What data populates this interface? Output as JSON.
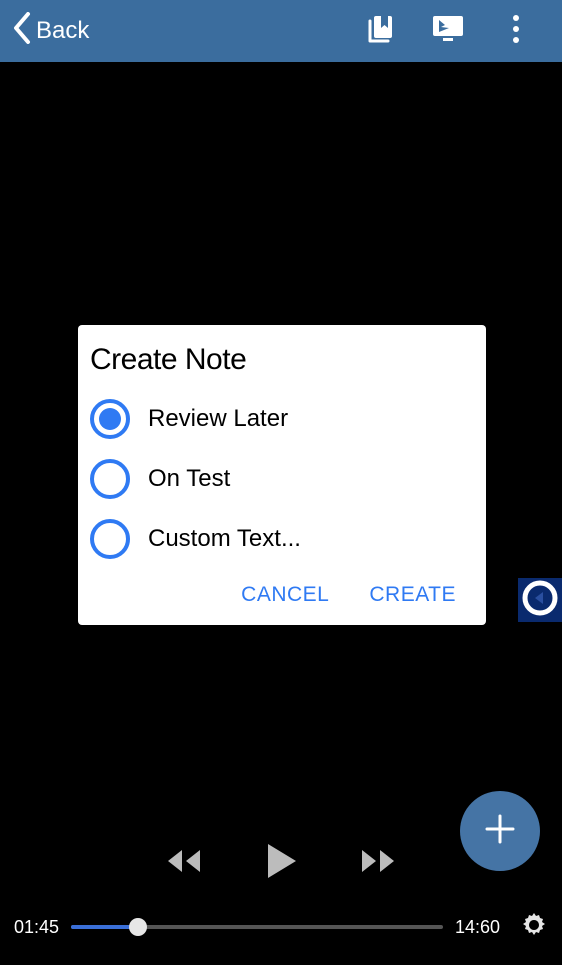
{
  "topbar": {
    "back_label": "Back"
  },
  "dialog": {
    "title": "Create Note",
    "options": [
      {
        "label": "Review Later",
        "selected": true
      },
      {
        "label": "On Test",
        "selected": false
      },
      {
        "label": "Custom Text...",
        "selected": false
      }
    ],
    "cancel_label": "CANCEL",
    "create_label": "CREATE"
  },
  "player": {
    "current_time": "01:45",
    "total_time": "14:60",
    "progress_percent": 12
  },
  "colors": {
    "topbar_bg": "#3b6d9e",
    "accent_blue": "#2f7af3",
    "fab_bg": "#4574a5",
    "progress_fill": "#3a6fd8"
  }
}
